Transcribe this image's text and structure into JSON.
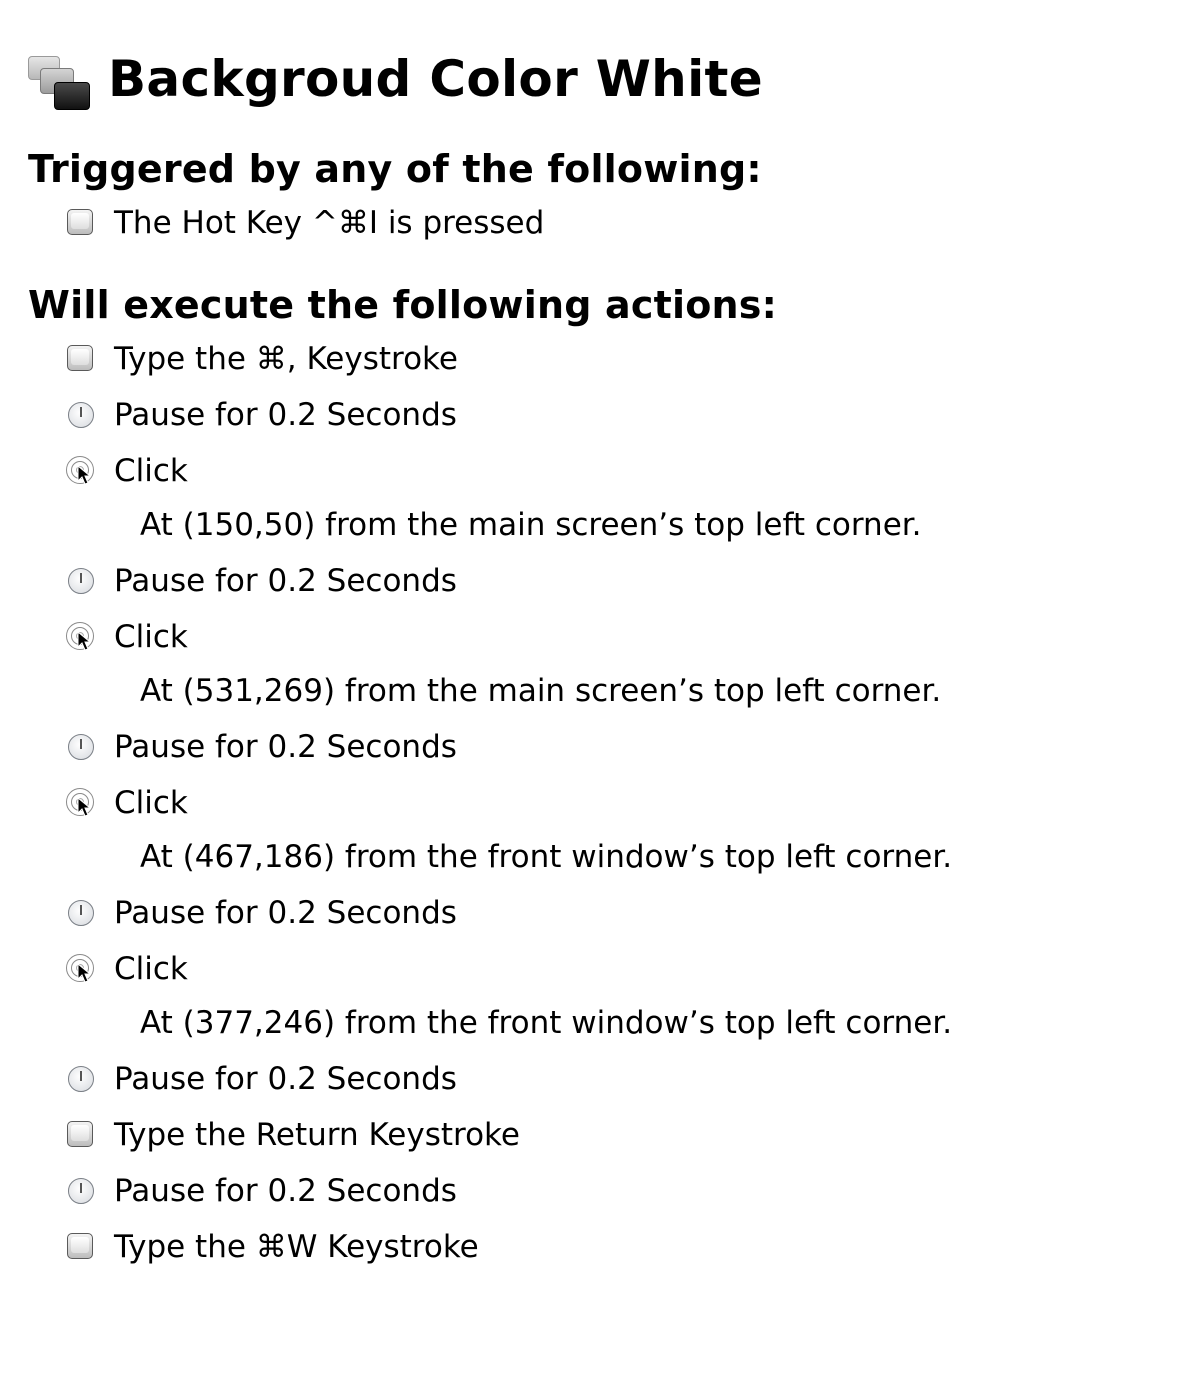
{
  "macro": {
    "title": "Backgroud Color White"
  },
  "triggers": {
    "heading": "Triggered by any of the following:",
    "items": [
      {
        "icon": "keystroke-icon",
        "label": "The Hot Key ^⌘I is pressed"
      }
    ]
  },
  "actions": {
    "heading": "Will execute the following actions:",
    "items": [
      {
        "icon": "keystroke-icon",
        "label": "Type the ⌘, Keystroke"
      },
      {
        "icon": "clock-icon",
        "label": "Pause for 0.2 Seconds"
      },
      {
        "icon": "click-icon",
        "label": "Click",
        "detail": "At (150,50) from the main screen’s top left corner."
      },
      {
        "icon": "clock-icon",
        "label": "Pause for 0.2 Seconds"
      },
      {
        "icon": "click-icon",
        "label": "Click",
        "detail": "At (531,269) from the main screen’s top left corner."
      },
      {
        "icon": "clock-icon",
        "label": "Pause for 0.2 Seconds"
      },
      {
        "icon": "click-icon",
        "label": "Click",
        "detail": "At (467,186) from the front window’s top left corner."
      },
      {
        "icon": "clock-icon",
        "label": "Pause for 0.2 Seconds"
      },
      {
        "icon": "click-icon",
        "label": "Click",
        "detail": "At (377,246) from the front window’s top left corner."
      },
      {
        "icon": "clock-icon",
        "label": "Pause for 0.2 Seconds"
      },
      {
        "icon": "keystroke-icon",
        "label": "Type the Return Keystroke"
      },
      {
        "icon": "clock-icon",
        "label": "Pause for 0.2 Seconds"
      },
      {
        "icon": "keystroke-icon",
        "label": "Type the ⌘W Keystroke"
      }
    ]
  }
}
